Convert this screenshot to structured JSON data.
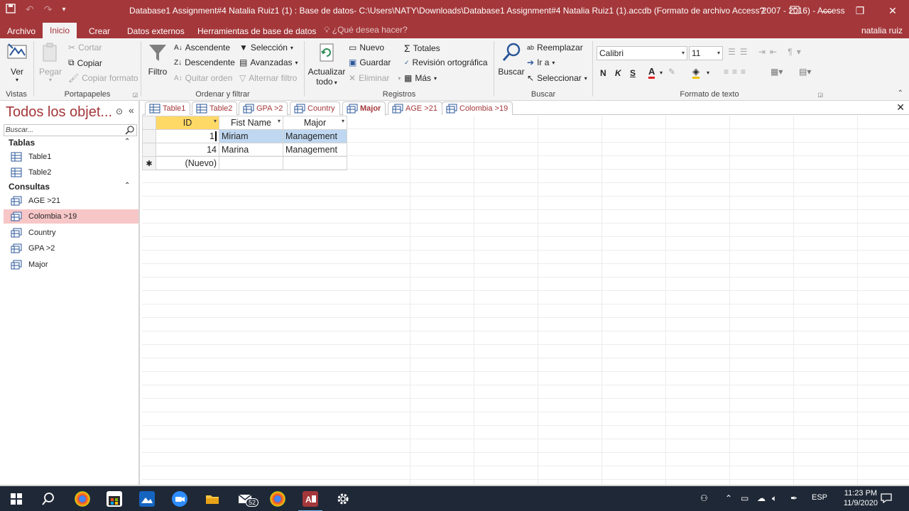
{
  "window": {
    "title": "Database1 Assignment#4 Natalia Ruiz1 (1) : Base de datos- C:\\Users\\NATY\\Downloads\\Database1 Assignment#4 Natalia Ruiz1 (1).accdb (Formato de archivo Access 2007 - 2016) - Access",
    "help": "?",
    "minimize": "—",
    "restore": "❐",
    "close": "✕"
  },
  "ribbon_tabs": {
    "archivo": "Archivo",
    "inicio": "Inicio",
    "crear": "Crear",
    "datos_externos": "Datos externos",
    "herramientas": "Herramientas de base de datos",
    "search_hint": "¿Qué desea hacer?",
    "user": "natalia ruiz"
  },
  "ribbon": {
    "vistas": {
      "label": "Vistas",
      "ver": "Ver"
    },
    "portapapeles": {
      "label": "Portapapeles",
      "pegar": "Pegar",
      "cortar": "Cortar",
      "copiar": "Copiar",
      "copiar_formato": "Copiar formato"
    },
    "ordenar": {
      "label": "Ordenar y filtrar",
      "filtro": "Filtro",
      "ascendente": "Ascendente",
      "descendente": "Descendente",
      "quitar_orden": "Quitar orden",
      "seleccion": "Selección",
      "avanzadas": "Avanzadas",
      "alternar_filtro": "Alternar filtro"
    },
    "registros": {
      "label": "Registros",
      "actualizar": "Actualizar",
      "actualizar2": "todo",
      "nuevo": "Nuevo",
      "guardar": "Guardar",
      "eliminar": "Eliminar",
      "totales": "Totales",
      "revision": "Revisión ortográfica",
      "mas": "Más"
    },
    "buscar": {
      "label": "Buscar",
      "buscar": "Buscar",
      "reemplazar": "Reemplazar",
      "ir_a": "Ir a",
      "seleccionar": "Seleccionar"
    },
    "formato": {
      "label": "Formato de texto",
      "font": "Calibri",
      "size": "11",
      "bold": "N",
      "italic": "K",
      "underline": "S"
    }
  },
  "nav": {
    "title": "Todos los objet...",
    "search_placeholder": "Buscar...",
    "tablas_label": "Tablas",
    "tablas": [
      "Table1",
      "Table2"
    ],
    "consultas_label": "Consultas",
    "consultas": [
      "AGE >21",
      "Colombia >19",
      "Country",
      "GPA >2",
      "Major"
    ],
    "selected": "Colombia >19"
  },
  "doc_tabs": [
    "Table1",
    "Table2",
    "GPA >2",
    "Country",
    "Major",
    "AGE >21",
    "Colombia >19"
  ],
  "active_doc_tab": "Major",
  "datasheet": {
    "columns": [
      "ID",
      "Fist Name",
      "Major"
    ],
    "rows": [
      {
        "id": "1",
        "first": "Miriam",
        "major": "Management"
      },
      {
        "id": "14",
        "first": "Marina",
        "major": "Management"
      }
    ],
    "new_row_label": "(Nuevo)"
  },
  "taskbar": {
    "mail_badge": "52",
    "lang": "ESP",
    "time": "11:23 PM",
    "date": "11/9/2020"
  },
  "colors": {
    "access_red": "#a4373a",
    "selected_nav": "#f7c6c7",
    "header_highlight": "#ffd966",
    "row_highlight": "#bfd7f0"
  }
}
